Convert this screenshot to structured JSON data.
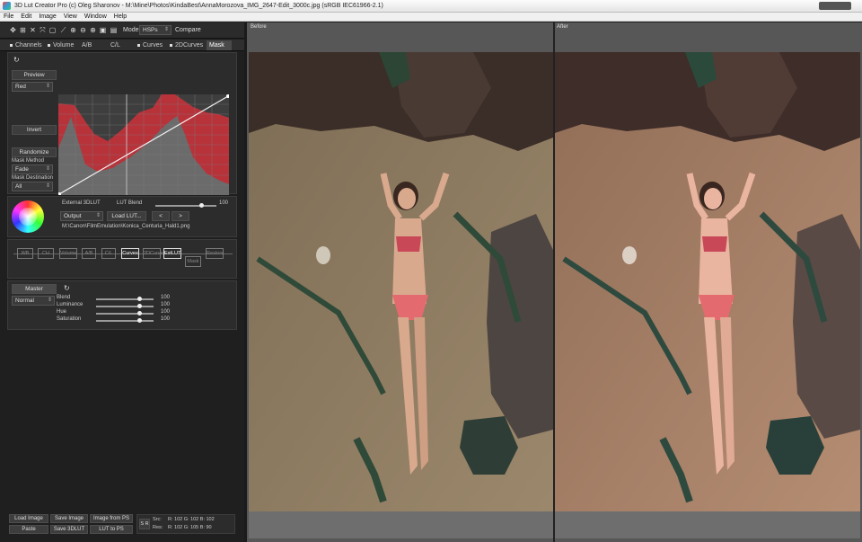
{
  "titlebar": {
    "title": "3D Lut Creator Pro (c) Oleg Sharonov - M:\\Mine\\Photos\\KindaBest\\AnnaMorozova_IMG_2647-Edit_3000c.jpg (sRGB IEC61966-2.1)"
  },
  "menu": [
    "File",
    "Edit",
    "Image",
    "View",
    "Window",
    "Help"
  ],
  "toolbar": {
    "model_label": "Model",
    "model_value": "HSPs",
    "compare_label": "Compare"
  },
  "tabs": [
    {
      "label": "Channels"
    },
    {
      "label": "Volume"
    },
    {
      "label": "A/B"
    },
    {
      "label": "C/L"
    },
    {
      "label": "Curves"
    },
    {
      "label": "2DCurves"
    },
    {
      "label": "Mask",
      "active": true
    }
  ],
  "mask": {
    "preview_label": "Preview",
    "channel_value": "Red",
    "invert_label": "Invert",
    "randomize_label": "Randomize",
    "method_label": "Mask Method",
    "method_value": "Fade",
    "destination_label": "Mask Destination",
    "destination_value": "All"
  },
  "external_lut": {
    "title": "External 3DLUT",
    "blend_label": "LUT Blend",
    "blend_value": "100",
    "output_value": "Output",
    "load_label": "Load LUT...",
    "prev_label": "<",
    "next_label": ">",
    "path": "M:\\Canon\\FilmEmulation\\Konica_Centuria_Hald1.png"
  },
  "pipeline": {
    "nodes": [
      "WB",
      "CH",
      "Volume",
      "A/B",
      "C/L",
      "Curves",
      "2DCurves",
      "ExtLUT",
      "Mask",
      "Restore"
    ]
  },
  "master": {
    "tab_label": "Master",
    "blend_mode": "Normal",
    "sliders": [
      {
        "label": "Blend",
        "value": "100"
      },
      {
        "label": "Luminance",
        "value": "100"
      },
      {
        "label": "Hue",
        "value": "100"
      },
      {
        "label": "Saturation",
        "value": "100"
      }
    ]
  },
  "bottom": {
    "load_image": "Load Image",
    "save_image": "Save Image",
    "image_from_ps": "Image from PS",
    "paste": "Paste",
    "save_3dlut": "Save 3DLUT",
    "lut_to_ps": "LUT to PS",
    "sr_label": "S R",
    "src_label": "Src:",
    "res_label": "Res:",
    "src_values": "R: 102   G: 102   B: 102",
    "res_values": "R: 102   G: 105   B: 90"
  },
  "views": {
    "before_label": "Before",
    "after_label": "After"
  },
  "colors": {
    "accent_red": "#c6363c",
    "panel": "#2c2c2c",
    "viewer_bg": "#575757"
  }
}
